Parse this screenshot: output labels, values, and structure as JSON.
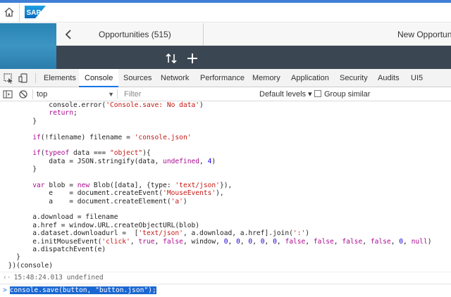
{
  "colors": {
    "accent": "#3f80d6",
    "devtools_active_tab": "#1a73e8",
    "keyword": "#aa0d91",
    "string": "#c41a16",
    "number": "#1c00cf",
    "selection": "#1a67d2"
  },
  "shell": {
    "logo_text": "SAP"
  },
  "app": {
    "title_left": "Opportunities (515)",
    "title_right": "New Opportunity"
  },
  "devtools": {
    "tabs": [
      "Elements",
      "Console",
      "Sources",
      "Network",
      "Performance",
      "Memory",
      "Application",
      "Security",
      "Audits",
      "UI5"
    ],
    "active_tab": "Console",
    "toolbar": {
      "context": "top",
      "filter_placeholder": "Filter",
      "levels": "Default levels ▾",
      "group_similar": "Group similar"
    },
    "console": {
      "code_lines": [
        [
          [
            "plain",
            "            console.error("
          ],
          [
            "str",
            "'Console.save: No data'"
          ],
          [
            "plain",
            ")"
          ]
        ],
        [
          [
            "plain",
            "            "
          ],
          [
            "kw",
            "return"
          ],
          [
            "plain",
            ";"
          ]
        ],
        [
          [
            "plain",
            "        }"
          ]
        ],
        [
          [
            "plain",
            ""
          ]
        ],
        [
          [
            "plain",
            "        "
          ],
          [
            "kw",
            "if"
          ],
          [
            "plain",
            "(!filename) filename = "
          ],
          [
            "str",
            "'console.json'"
          ]
        ],
        [
          [
            "plain",
            ""
          ]
        ],
        [
          [
            "plain",
            "        "
          ],
          [
            "kw",
            "if"
          ],
          [
            "plain",
            "("
          ],
          [
            "kw",
            "typeof"
          ],
          [
            "plain",
            " data === "
          ],
          [
            "str",
            "\"object\""
          ],
          [
            "plain",
            "){"
          ]
        ],
        [
          [
            "plain",
            "            data = JSON.stringify(data, "
          ],
          [
            "kw",
            "undefined"
          ],
          [
            "plain",
            ", "
          ],
          [
            "num",
            "4"
          ],
          [
            "plain",
            ")"
          ]
        ],
        [
          [
            "plain",
            "        }"
          ]
        ],
        [
          [
            "plain",
            ""
          ]
        ],
        [
          [
            "plain",
            "        "
          ],
          [
            "kw",
            "var"
          ],
          [
            "plain",
            " blob = "
          ],
          [
            "kw",
            "new"
          ],
          [
            "plain",
            " Blob([data], {type: "
          ],
          [
            "str",
            "'text/json'"
          ],
          [
            "plain",
            "}),"
          ]
        ],
        [
          [
            "plain",
            "            e    = document.createEvent("
          ],
          [
            "str",
            "'MouseEvents'"
          ],
          [
            "plain",
            "),"
          ]
        ],
        [
          [
            "plain",
            "            a    = document.createElement("
          ],
          [
            "str",
            "'a'"
          ],
          [
            "plain",
            ")"
          ]
        ],
        [
          [
            "plain",
            ""
          ]
        ],
        [
          [
            "plain",
            "        a.download = filename"
          ]
        ],
        [
          [
            "plain",
            "        a.href = window.URL.createObjectURL(blob)"
          ]
        ],
        [
          [
            "plain",
            "        a.dataset.downloadurl =  ["
          ],
          [
            "str",
            "'text/json'"
          ],
          [
            "plain",
            ", a.download, a.href].join("
          ],
          [
            "str",
            "':'"
          ],
          [
            "plain",
            ")"
          ]
        ],
        [
          [
            "plain",
            "        e.initMouseEvent("
          ],
          [
            "str",
            "'click'"
          ],
          [
            "plain",
            ", "
          ],
          [
            "kw",
            "true"
          ],
          [
            "plain",
            ", "
          ],
          [
            "kw",
            "false"
          ],
          [
            "plain",
            ", window, "
          ],
          [
            "num",
            "0"
          ],
          [
            "plain",
            ", "
          ],
          [
            "num",
            "0"
          ],
          [
            "plain",
            ", "
          ],
          [
            "num",
            "0"
          ],
          [
            "plain",
            ", "
          ],
          [
            "num",
            "0"
          ],
          [
            "plain",
            ", "
          ],
          [
            "num",
            "0"
          ],
          [
            "plain",
            ", "
          ],
          [
            "kw",
            "false"
          ],
          [
            "plain",
            ", "
          ],
          [
            "kw",
            "false"
          ],
          [
            "plain",
            ", "
          ],
          [
            "kw",
            "false"
          ],
          [
            "plain",
            ", "
          ],
          [
            "kw",
            "false"
          ],
          [
            "plain",
            ", "
          ],
          [
            "num",
            "0"
          ],
          [
            "plain",
            ", "
          ],
          [
            "kw",
            "null"
          ],
          [
            "plain",
            ")"
          ]
        ],
        [
          [
            "plain",
            "        a.dispatchEvent(e)"
          ]
        ],
        [
          [
            "plain",
            "    }"
          ]
        ],
        [
          [
            "plain",
            "  })(console)"
          ]
        ]
      ],
      "result_marker": "‹·",
      "result_text": "15:48:24.013 undefined",
      "prompt_marker": ">",
      "input_text": "console.save(button, \"button.json\");"
    }
  }
}
